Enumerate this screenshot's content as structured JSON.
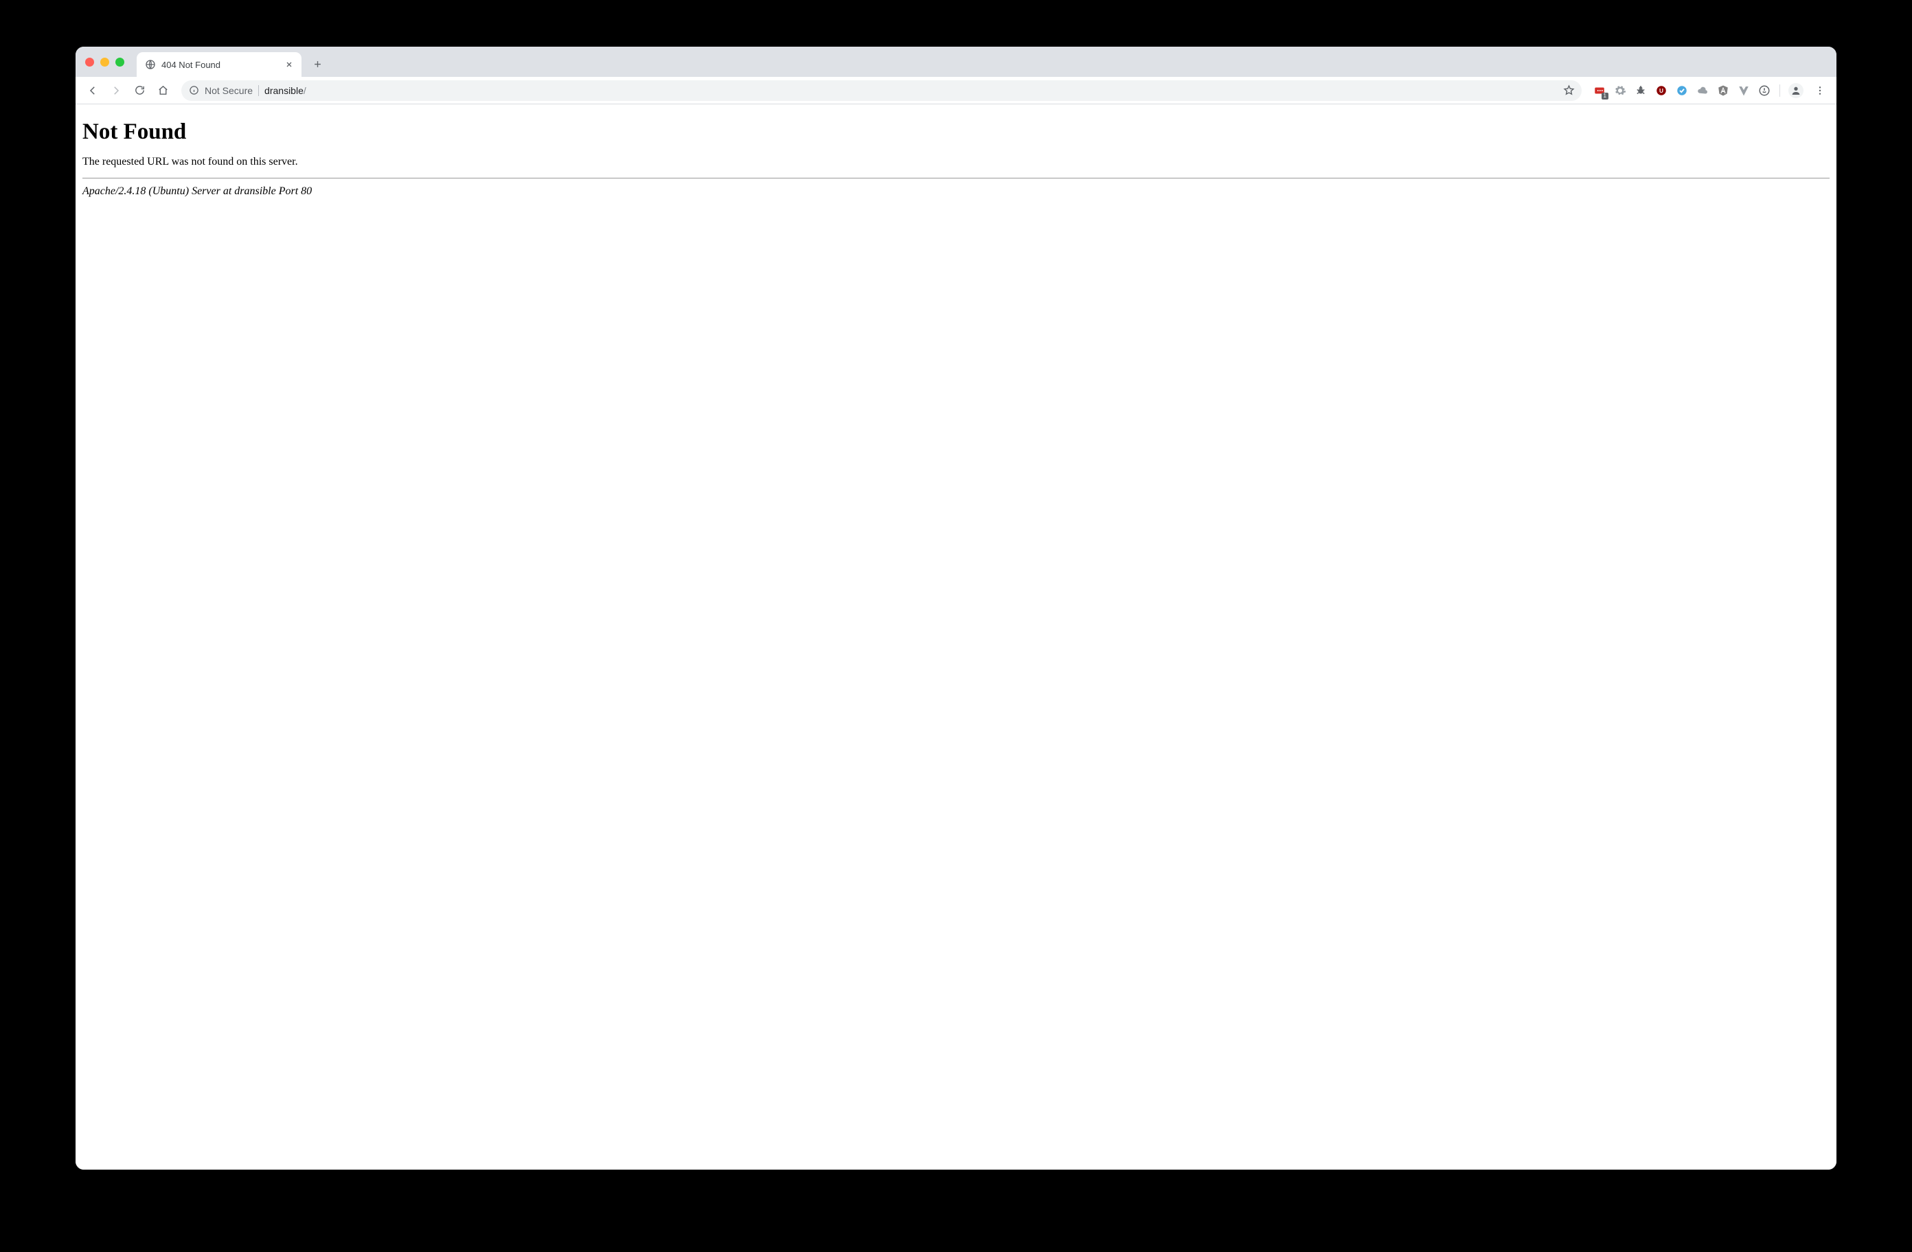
{
  "browser": {
    "tab": {
      "title": "404 Not Found"
    },
    "address": {
      "security_label": "Not Secure",
      "host": "dransible",
      "path_suffix": "/"
    },
    "extension_badge": "1"
  },
  "page": {
    "heading": "Not Found",
    "message": "The requested URL was not found on this server.",
    "server_signature": "Apache/2.4.18 (Ubuntu) Server at dransible Port 80"
  }
}
